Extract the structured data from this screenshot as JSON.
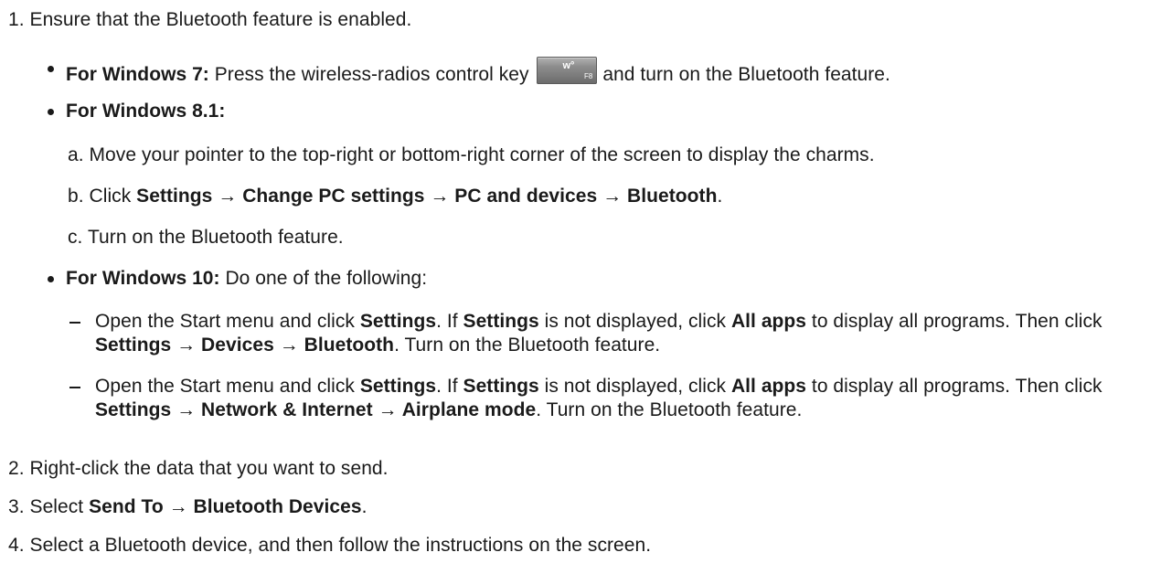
{
  "steps": {
    "s1": {
      "num": "1.",
      "text": "Ensure that the Bluetooth feature is enabled."
    },
    "win7": {
      "label": "For Windows 7:",
      "text_before_key": " Press the wireless-radios control key",
      "key_glyph": "ᴡ°",
      "key_label": "F8",
      "text_after_key": " and turn on the Bluetooth feature."
    },
    "win81": {
      "label": "For Windows 8.1:",
      "a": {
        "num": "a.",
        "text": "Move your pointer to the top-right or bottom-right corner of the screen to display the charms."
      },
      "b": {
        "num": "b.",
        "pre": "Click ",
        "path": "Settings → Change PC settings → PC and devices → Bluetooth",
        "post": "."
      },
      "c": {
        "num": "c.",
        "text": "Turn on the Bluetooth feature."
      }
    },
    "win10": {
      "label": "For Windows 10:",
      "text": " Do one of the following:",
      "opt1": {
        "p1": "Open the Start menu and click ",
        "b1": "Settings",
        "p2": ". If ",
        "b2": "Settings",
        "p3": " is not displayed, click ",
        "b3": "All apps",
        "p4": " to display all programs. Then click ",
        "b4": "Settings → Devices → Bluetooth",
        "p5": ". Turn on the Bluetooth feature."
      },
      "opt2": {
        "p1": "Open the Start menu and click ",
        "b1": "Settings",
        "p2": ". If ",
        "b2": "Settings",
        "p3": " is not displayed, click ",
        "b3": "All apps",
        "p4": " to display all programs. Then click ",
        "b4": "Settings → Network & Internet → Airplane mode",
        "p5": ". Turn on the Bluetooth feature."
      }
    },
    "s2": {
      "num": "2.",
      "text": "Right-click the data that you want to send."
    },
    "s3": {
      "num": "3.",
      "pre": "Select ",
      "path": "Send To → Bluetooth Devices",
      "post": "."
    },
    "s4": {
      "num": "4.",
      "text": "Select a Bluetooth device, and then follow the instructions on the screen."
    }
  }
}
